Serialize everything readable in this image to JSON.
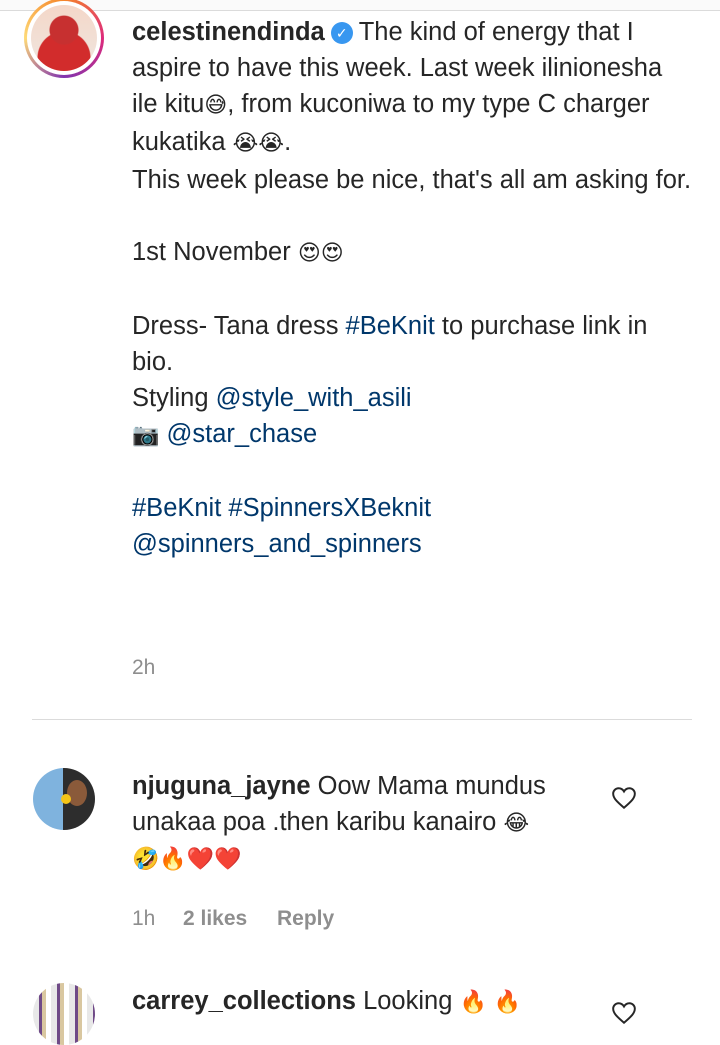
{
  "post": {
    "username": "celestinendinda",
    "verified_glyph": "✓",
    "caption_line1": "The kind of energy that I aspire to have this week. Last week ilinionesha ile kitu",
    "emoji_sweat_smile": "😅",
    "caption_line2": ", from kuconiwa to my type C charger kukatika",
    "emoji_crying": "😭😭",
    "caption_line2_end": ".",
    "caption_line3": "This week please be nice, that's all am asking for.",
    "date_text": "1st November",
    "emoji_heart_eyes": "😍😍",
    "dress_prefix": "Dress- Tana dress ",
    "dress_hashtag": "#BeKnit",
    "dress_suffix": " to purchase link in bio.",
    "styling_prefix": "Styling ",
    "styling_handle": "@style_with_asili",
    "camera_emoji": "📷",
    "photo_handle": "@star_chase",
    "hashtags": "#BeKnit #SpinnersXBeknit",
    "mention": "@spinners_and_spinners",
    "time": "2h"
  },
  "comments": [
    {
      "username": "njuguna_jayne",
      "text": "Oow Mama mundus unakaa poa .then karibu kanairo ",
      "emoji_laugh": "😂",
      "emoji_row": "🤣🔥❤️❤️",
      "time": "1h",
      "likes": "2 likes",
      "reply": "Reply",
      "like_icon": "heart-outline-icon"
    },
    {
      "username": "carrey_collections",
      "text": "Looking ",
      "emoji_row": "🔥 🔥",
      "like_icon": "heart-outline-icon"
    }
  ]
}
